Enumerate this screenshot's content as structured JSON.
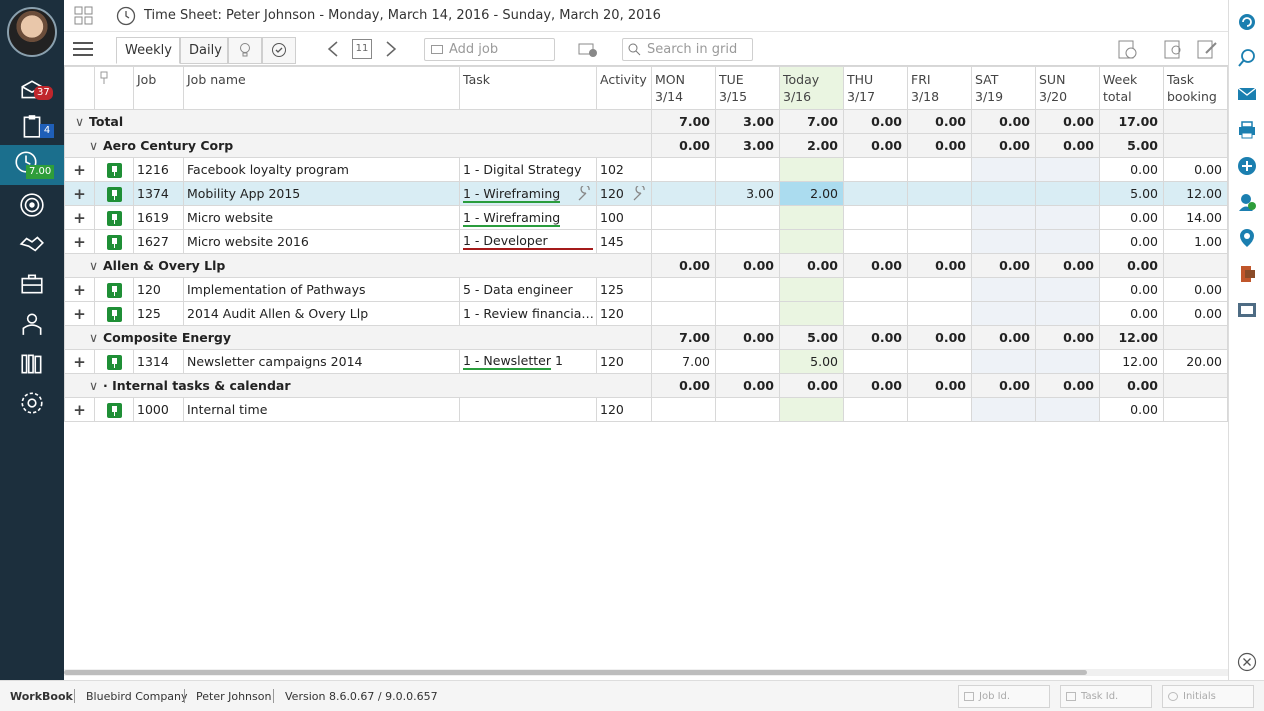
{
  "app": {
    "name": "WorkBook",
    "company": "Bluebird Company",
    "user": "Peter Johnson",
    "version": "Version 8.6.0.67 / 9.0.0.657"
  },
  "sidebar": {
    "badges": {
      "inbox": "37",
      "tasks": "4",
      "timesheet": "7.00"
    }
  },
  "header": {
    "title": "Time Sheet: Peter Johnson - Monday, March 14, 2016 - Sunday, March 20, 2016"
  },
  "toolbar": {
    "tab_weekly": "Weekly",
    "tab_daily": "Daily",
    "date_day": "11",
    "add_job_placeholder": "Add job",
    "search_placeholder": "Search in grid"
  },
  "grid": {
    "columns": {
      "job": "Job",
      "job_name": "Job name",
      "task": "Task",
      "activity": "Activity",
      "mon": "MON",
      "mon_date": "3/14",
      "tue": "TUE",
      "tue_date": "3/15",
      "today": "Today",
      "today_date": "3/16",
      "thu": "THU",
      "thu_date": "3/17",
      "fri": "FRI",
      "fri_date": "3/18",
      "sat": "SAT",
      "sat_date": "3/19",
      "sun": "SUN",
      "sun_date": "3/20",
      "week": "Week",
      "week2": "total",
      "taskb": "Task",
      "taskb2": "booking"
    },
    "total": {
      "label": "Total",
      "mon": "7.00",
      "tue": "3.00",
      "wed": "7.00",
      "thu": "0.00",
      "fri": "0.00",
      "sat": "0.00",
      "sun": "0.00",
      "week": "17.00"
    },
    "groups": [
      {
        "name": "Aero Century Corp",
        "mon": "0.00",
        "tue": "3.00",
        "wed": "2.00",
        "thu": "0.00",
        "fri": "0.00",
        "sat": "0.00",
        "sun": "0.00",
        "week": "5.00"
      },
      {
        "name": "Allen & Overy Llp",
        "mon": "0.00",
        "tue": "0.00",
        "wed": "0.00",
        "thu": "0.00",
        "fri": "0.00",
        "sat": "0.00",
        "sun": "0.00",
        "week": "0.00"
      },
      {
        "name": "Composite Energy",
        "mon": "7.00",
        "tue": "0.00",
        "wed": "5.00",
        "thu": "0.00",
        "fri": "0.00",
        "sat": "0.00",
        "sun": "0.00",
        "week": "12.00"
      },
      {
        "name": "· Internal tasks & calendar",
        "mon": "0.00",
        "tue": "0.00",
        "wed": "0.00",
        "thu": "0.00",
        "fri": "0.00",
        "sat": "0.00",
        "sun": "0.00",
        "week": "0.00"
      }
    ],
    "rows": [
      {
        "job": "1216",
        "name": "Facebook loyalty program",
        "task": "1 - Digital Strategy",
        "activity": "102",
        "mon": "",
        "tue": "",
        "wed": "",
        "week": "0.00",
        "booking": "0.00"
      },
      {
        "job": "1374",
        "name": "Mobility App 2015",
        "task": "1 - Wireframing",
        "activity": "120",
        "mon": "",
        "tue": "3.00",
        "wed": "2.00",
        "week": "5.00",
        "booking": "12.00"
      },
      {
        "job": "1619",
        "name": "Micro website",
        "task": "1 - Wireframing",
        "activity": "100",
        "mon": "",
        "tue": "",
        "wed": "",
        "week": "0.00",
        "booking": "14.00"
      },
      {
        "job": "1627",
        "name": "Micro website 2016",
        "task": "1 - Developer",
        "activity": "145",
        "mon": "",
        "tue": "",
        "wed": "",
        "week": "0.00",
        "booking": "1.00"
      },
      {
        "job": "120",
        "name": "Implementation of Pathways",
        "task": "5 - Data engineer",
        "activity": "125",
        "mon": "",
        "tue": "",
        "wed": "",
        "week": "0.00",
        "booking": "0.00"
      },
      {
        "job": "125",
        "name": "2014 Audit Allen & Overy Llp",
        "task": "1 - Review financia…",
        "activity": "120",
        "mon": "",
        "tue": "",
        "wed": "",
        "week": "0.00",
        "booking": "0.00"
      },
      {
        "job": "1314",
        "name": "Newsletter campaigns 2014",
        "task": "1 - Newsletter 1",
        "activity": "120",
        "mon": "7.00",
        "tue": "",
        "wed": "5.00",
        "week": "12.00",
        "booking": "20.00"
      },
      {
        "job": "1000",
        "name": "Internal time",
        "task": "",
        "activity": "120",
        "mon": "",
        "tue": "",
        "wed": "",
        "week": "0.00",
        "booking": ""
      }
    ]
  },
  "statusbar": {
    "job_id": "Job Id.",
    "task_id": "Task Id.",
    "initials": "Initials"
  },
  "colors": {
    "sidebar": "#1c2f3d",
    "active": "#1b6f8d",
    "today": "#eaf5e1",
    "selected": "#d9edf4",
    "pin": "#1f8f36"
  }
}
